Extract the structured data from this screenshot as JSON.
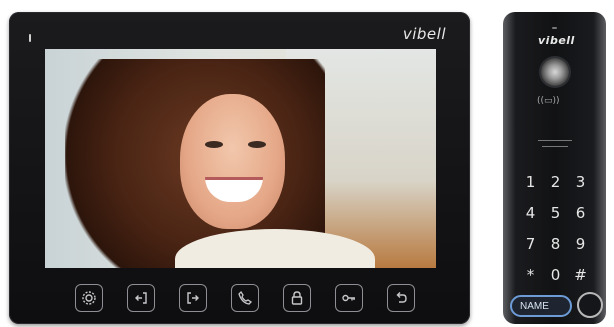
{
  "monitor": {
    "brand": "vibell",
    "buttons": [
      {
        "icon": "gear-icon"
      },
      {
        "icon": "exit-left-icon"
      },
      {
        "icon": "enter-right-icon"
      },
      {
        "icon": "phone-icon"
      },
      {
        "icon": "lock-icon"
      },
      {
        "icon": "key-icon"
      },
      {
        "icon": "back-icon"
      }
    ]
  },
  "panel": {
    "brand": "vibell",
    "rfid_label": "((▭))",
    "keys": [
      "1",
      "2",
      "3",
      "4",
      "5",
      "6",
      "7",
      "8",
      "9",
      "*",
      "0",
      "#"
    ],
    "name_label": "NAME"
  }
}
